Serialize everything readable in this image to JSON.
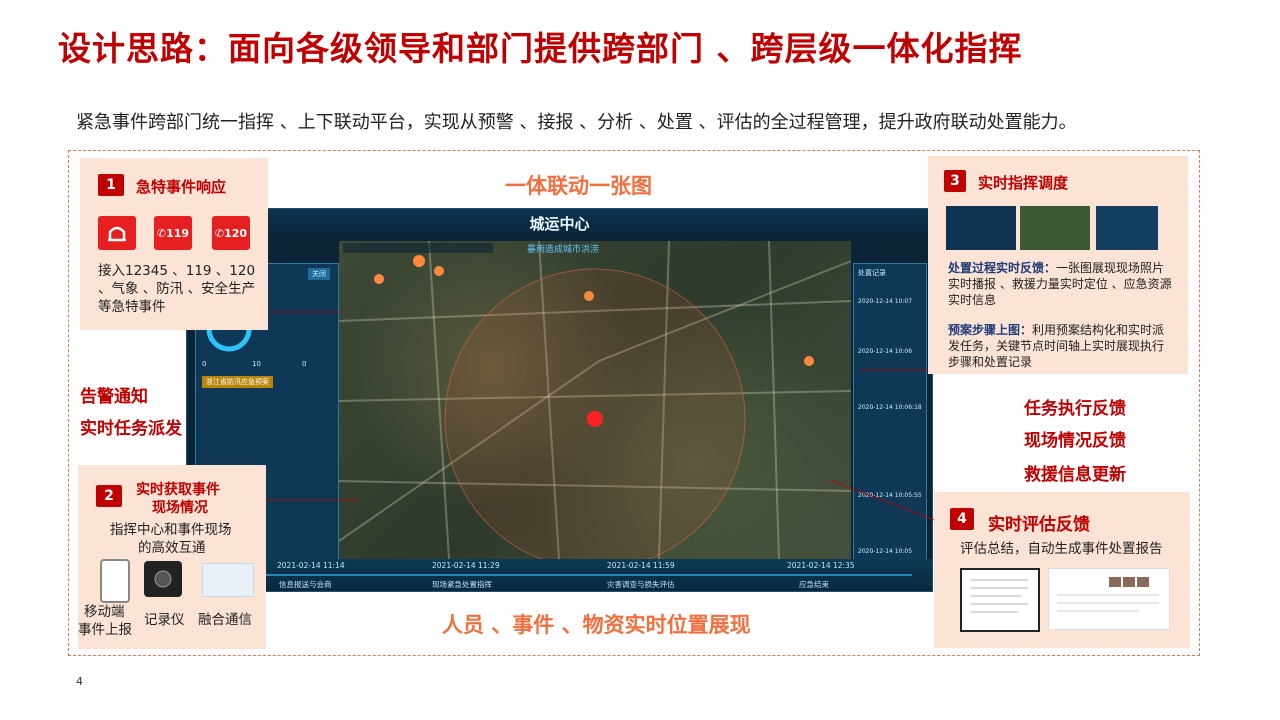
{
  "title": "设计思路：面向各级领导和部门提供跨部门 、跨层级一体化指挥",
  "subtitle": "紧急事件跨部门统一指挥 、上下联动平台，实现从预警 、接报 、分析 、处置 、评估的全过程管理，提升政府联动处置能力。",
  "center_label_top": "一体联动一张图",
  "center_label_bottom": "人员 、事件 、物资实时位置展现",
  "box1": {
    "num": "1",
    "heading": "急特事件响应",
    "icons": [
      {
        "name": "alarm-icon",
        "label": ""
      },
      {
        "name": "phone-119-icon",
        "label": "119"
      },
      {
        "name": "phone-120-icon",
        "label": "120"
      }
    ],
    "text": "接入12345 、119 、120 、气象 、防汛 、安全生产等急特事件"
  },
  "left_labels": [
    "告警通知",
    "实时任务派发"
  ],
  "box2": {
    "num": "2",
    "heading_line1": "实时获取事件",
    "heading_line2": "现场情况",
    "text_line1": "指挥中心和事件现场",
    "text_line2": "的高效互通",
    "devices": [
      {
        "name": "mobile-device-icon",
        "label_line1": "移动端",
        "label_line2": "事件上报"
      },
      {
        "name": "recorder-device-icon",
        "label_line1": "记录仪",
        "label_line2": ""
      },
      {
        "name": "fusion-comm-icon",
        "label_line1": "融合通信",
        "label_line2": ""
      }
    ]
  },
  "box3": {
    "num": "3",
    "heading": "实时指挥调度",
    "p1_bold": "处置过程实时反馈：",
    "p1_text": "一张图展现现场照片实时播报 、救援力量实时定位 、应急资源实时信息",
    "p2_bold": "预案步骤上图：",
    "p2_text": "利用预案结构化和实时派发任务，关键节点时间轴上实时展现执行步骤和处置记录"
  },
  "right_labels": [
    "任务执行反馈",
    "现场情况反馈",
    "救援信息更新"
  ],
  "box4": {
    "num": "4",
    "heading": "实时评估反馈",
    "text": "评估总结，自动生成事件处置报告"
  },
  "screen": {
    "title": "城运中心",
    "map_caption": "暴雨造成城市洪涝",
    "left_panel_btn": "关闭",
    "left_panel_alert": "浙江省防汛应急预案",
    "counts": [
      "0",
      "10",
      "0"
    ],
    "right_panel_tab": "处置记录",
    "right_times": [
      "2020-12-14 10:07",
      "2020-12-14 10:06",
      "2020-12-14 10:06:18",
      "2020-12-14 10:05:55",
      "2020-12-14 10:05"
    ],
    "timeline": [
      {
        "time": "2021-02-14 11:14",
        "label": "信息报送与会商"
      },
      {
        "time": "2021-02-14 11:29",
        "label": "现场紧急处置指挥"
      },
      {
        "time": "2021-02-14 11:59",
        "label": "灾害调查与损失评估"
      },
      {
        "time": "2021-02-14 12:35",
        "label": "应急结束"
      }
    ]
  },
  "page_number": "4",
  "colors": {
    "accent_red": "#c00000",
    "accent_orange": "#f0703f",
    "box_bg": "#fbe3d6"
  }
}
